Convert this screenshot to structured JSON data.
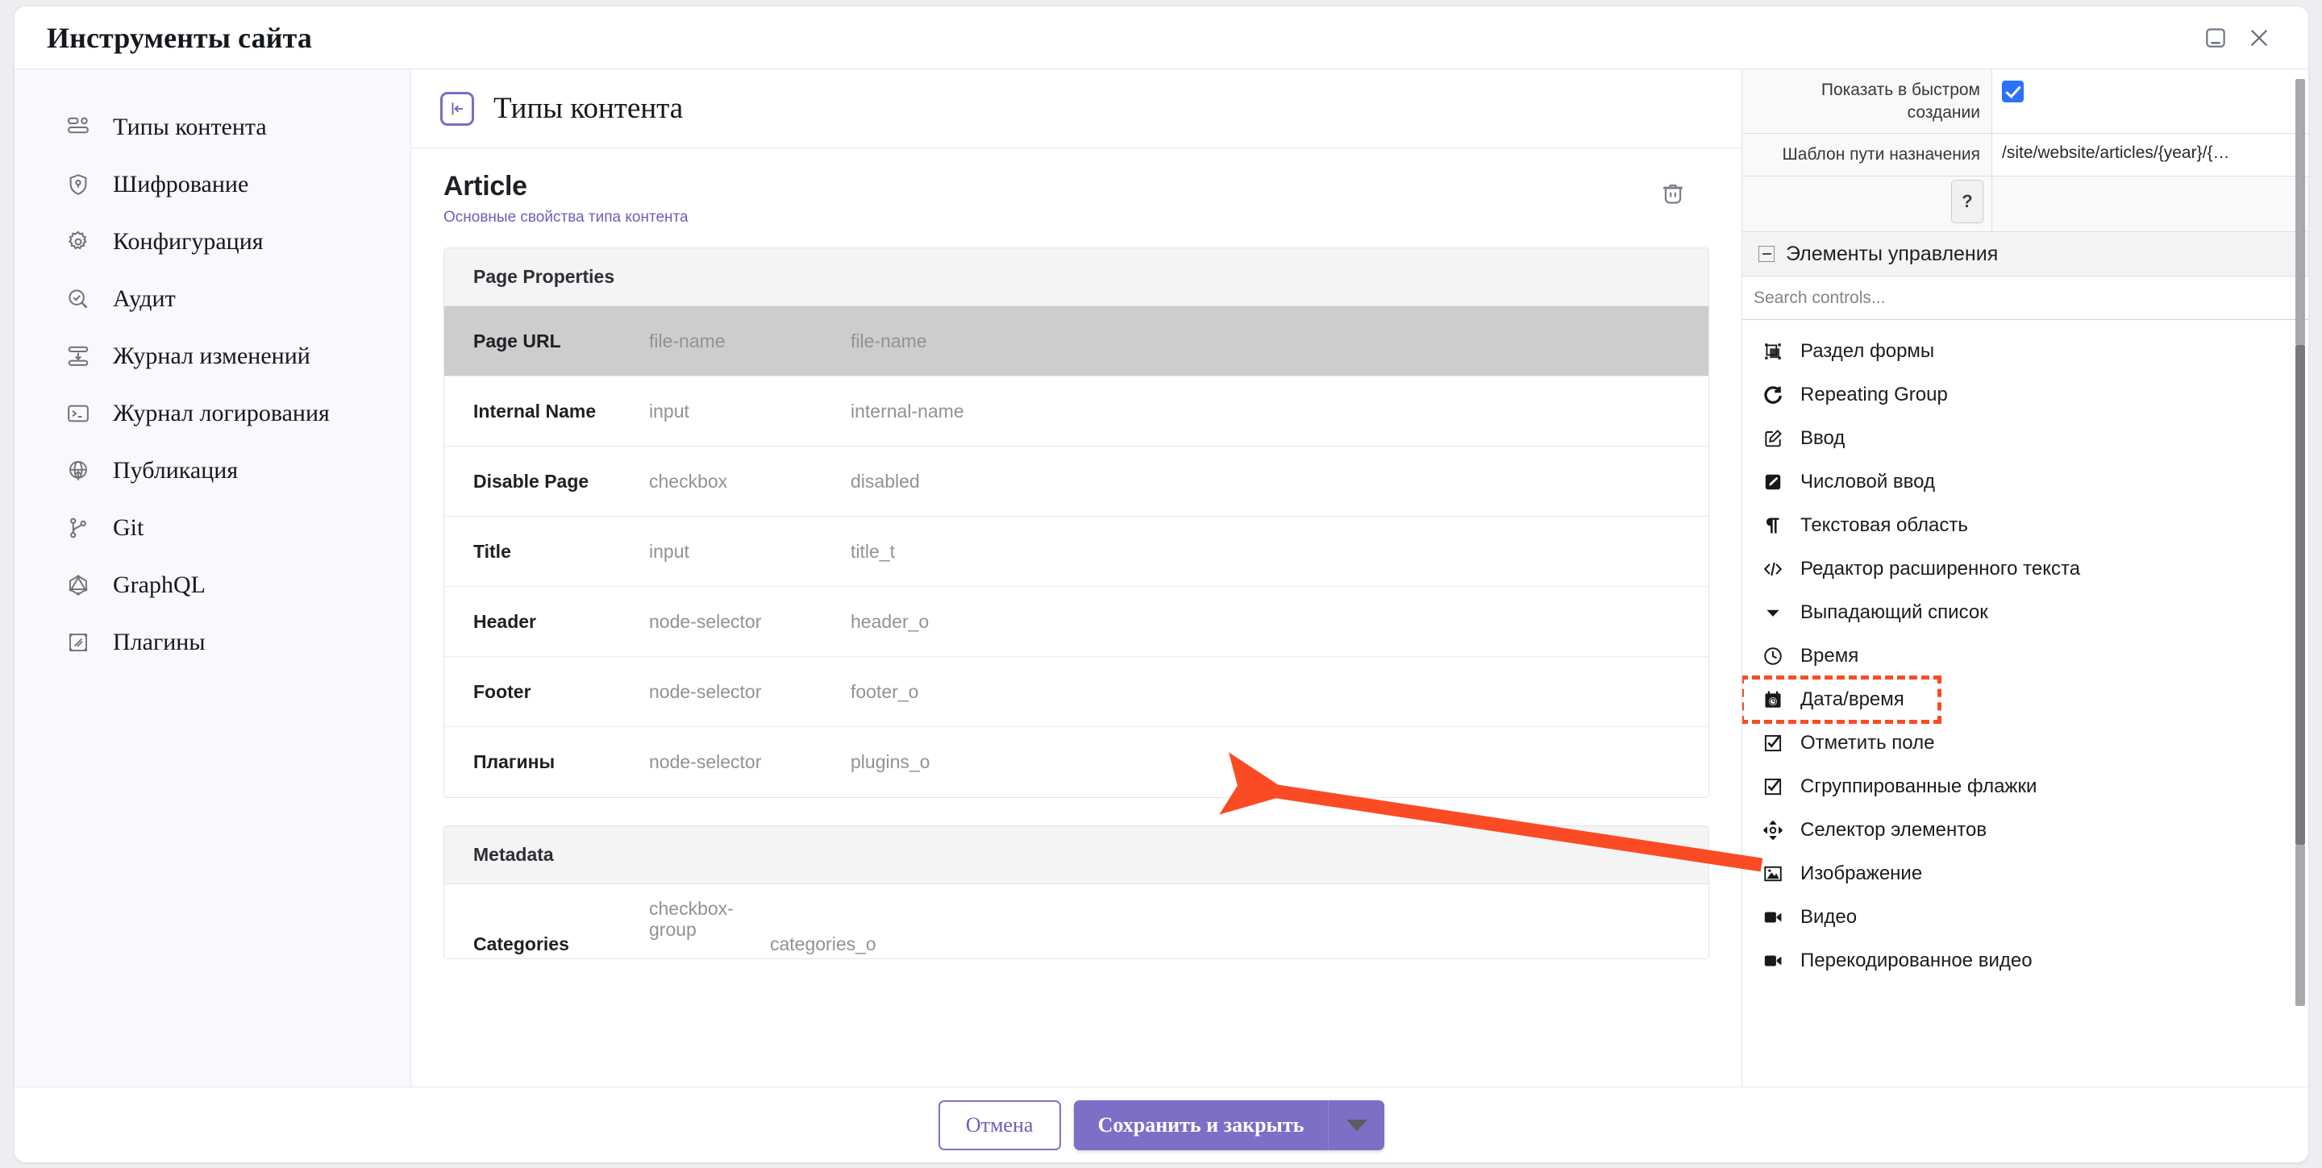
{
  "window": {
    "title": "Инструменты сайта",
    "minimize_icon": "minimize-icon",
    "close_icon": "close-icon"
  },
  "sidebar": {
    "items": [
      {
        "label": "Типы контента",
        "icon": "content-types-icon"
      },
      {
        "label": "Шифрование",
        "icon": "shield-lock-icon"
      },
      {
        "label": "Конфигурация",
        "icon": "gear-icon"
      },
      {
        "label": "Аудит",
        "icon": "search-check-icon"
      },
      {
        "label": "Журнал изменений",
        "icon": "changelog-icon"
      },
      {
        "label": "Журнал логирования",
        "icon": "terminal-icon"
      },
      {
        "label": "Публикация",
        "icon": "globe-publish-icon"
      },
      {
        "label": "Git",
        "icon": "git-branch-icon"
      },
      {
        "label": "GraphQL",
        "icon": "graphql-icon"
      },
      {
        "label": "Плагины",
        "icon": "plugins-icon"
      }
    ]
  },
  "center": {
    "header_title": "Типы контента",
    "collapse_icon": "collapse-panel-icon",
    "content_type_name": "Article",
    "content_type_subtitle": "Основные свойства типа контента",
    "delete_icon": "trash-icon",
    "sections": [
      {
        "title": "Page Properties",
        "rows": [
          {
            "label": "Page URL",
            "type": "file-name",
            "id": "file-name",
            "highlighted": true
          },
          {
            "label": "Internal Name",
            "type": "input",
            "id": "internal-name",
            "highlighted": false
          },
          {
            "label": "Disable Page",
            "type": "checkbox",
            "id": "disabled",
            "highlighted": false
          },
          {
            "label": "Title",
            "type": "input",
            "id": "title_t",
            "highlighted": false
          },
          {
            "label": "Header",
            "type": "node-selector",
            "id": "header_o",
            "highlighted": false
          },
          {
            "label": "Footer",
            "type": "node-selector",
            "id": "footer_o",
            "highlighted": false
          },
          {
            "label": "Плагины",
            "type": "node-selector",
            "id": "plugins_o",
            "highlighted": false
          }
        ]
      },
      {
        "title": "Metadata",
        "rows": [
          {
            "label": "Categories",
            "type": "checkbox-group",
            "id": "categories_o",
            "highlighted": false
          }
        ]
      }
    ]
  },
  "right_panel": {
    "properties": [
      {
        "label": "Показать в быстром создании",
        "kind": "checkbox",
        "checked": true
      },
      {
        "label": "Шаблон пути назначения",
        "kind": "text",
        "value": "/site/website/articles/{year}/{…"
      }
    ],
    "help_icon": "help-question-icon",
    "controls_section_title": "Элементы управления",
    "collapse_section_icon": "minus-icon",
    "search_placeholder": "Search controls...",
    "search_value": "",
    "controls": [
      {
        "label": "Раздел формы",
        "icon": "form-section-icon",
        "marked": false
      },
      {
        "label": "Repeating Group",
        "icon": "repeat-icon",
        "marked": false
      },
      {
        "label": "Ввод",
        "icon": "input-pencil-icon",
        "marked": false
      },
      {
        "label": "Числовой ввод",
        "icon": "number-input-icon",
        "marked": false
      },
      {
        "label": "Текстовая область",
        "icon": "pilcrow-icon",
        "marked": false
      },
      {
        "label": "Редактор расширенного текста",
        "icon": "code-brackets-icon",
        "marked": false
      },
      {
        "label": "Выпадающий список",
        "icon": "caret-down-icon",
        "marked": false
      },
      {
        "label": "Время",
        "icon": "clock-icon",
        "marked": false
      },
      {
        "label": "Дата/время",
        "icon": "calendar-clock-icon",
        "marked": true
      },
      {
        "label": "Отметить поле",
        "icon": "checkbox-icon",
        "marked": false
      },
      {
        "label": "Сгруппированные флажки",
        "icon": "checkbox-group-icon",
        "marked": false
      },
      {
        "label": "Селектор элементов",
        "icon": "item-selector-icon",
        "marked": false
      },
      {
        "label": "Изображение",
        "icon": "image-icon",
        "marked": false
      },
      {
        "label": "Видео",
        "icon": "video-icon",
        "marked": false
      },
      {
        "label": "Перекодированное видео",
        "icon": "video-transcode-icon",
        "marked": false
      }
    ]
  },
  "footer": {
    "cancel_label": "Отмена",
    "save_label": "Сохранить и закрыть",
    "save_caret_icon": "caret-down-icon"
  },
  "colors": {
    "accent_purple": "#7d6ec6",
    "annotation_orange": "#fa4b25",
    "checkbox_blue": "#2a72f8",
    "row_highlight": "#cdcdcd"
  }
}
